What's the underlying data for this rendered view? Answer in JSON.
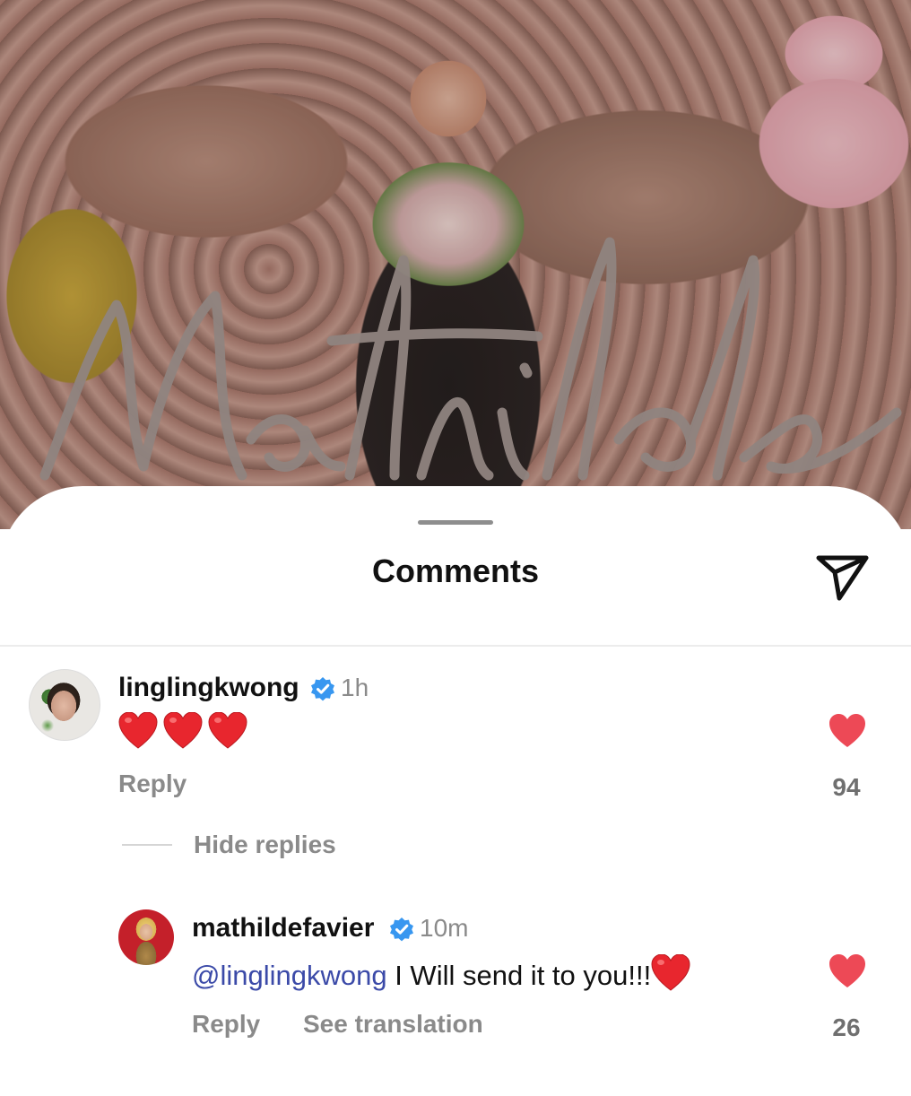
{
  "post_image": {
    "signature_text": "Mathilde"
  },
  "sheet": {
    "title": "Comments",
    "share_icon": "paper-plane-icon"
  },
  "comments": [
    {
      "username": "linglingkwong",
      "verified": true,
      "time": "1h",
      "text": "❤️❤️❤️",
      "reply_label": "Reply",
      "like_count": "94",
      "liked": true,
      "toggle_replies_label": "Hide replies",
      "replies": [
        {
          "username": "mathildefavier",
          "verified": true,
          "time": "10m",
          "mention": "@linglingkwong",
          "text": " I Will send it to you!!!",
          "reply_label": "Reply",
          "translation_label": "See translation",
          "like_count": "26",
          "liked": true
        }
      ]
    }
  ],
  "colors": {
    "like_red": "#ed4956",
    "verified_blue": "#3897f0",
    "mention_blue": "#3b4aa8",
    "muted_text": "#8a8a8a"
  }
}
